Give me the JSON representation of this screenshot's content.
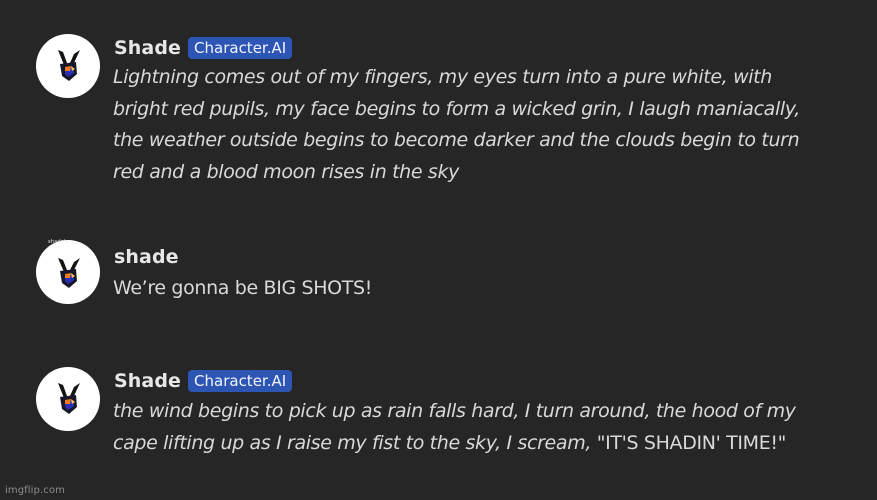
{
  "messages": [
    {
      "author": "Shade",
      "badge": "Character.AI",
      "italic": true,
      "text": "Lightning comes out of my fingers, my eyes turn into a pure white, with\nbright red pupils, my face begins to form a wicked grin, I laugh maniacally,\nthe weather outside begins to become darker and the clouds begin to turn\nred and a blood moon rises in the sky",
      "avatar_icon": "shadow-character-avatar-icon"
    },
    {
      "author": "shade",
      "badge": "",
      "italic": false,
      "avatar_caption": "shade's",
      "text": "We’re gonna be BIG SHOTS!",
      "avatar_icon": "shadow-character-avatar-icon"
    },
    {
      "author": "Shade",
      "badge": "Character.AI",
      "italic": true,
      "text_italic": "the wind begins to pick up as rain falls hard, I turn around, the hood of my\ncape lifting up as I raise my fist to the sky, I scream,  ",
      "text_upright": "\"IT'S SHADIN' TIME!\"",
      "avatar_icon": "shadow-character-avatar-icon"
    }
  ],
  "watermark": "imgflip.com",
  "colors": {
    "background": "#262627",
    "badge": "#2d56b4",
    "text": "#d9d9dc",
    "author": "#e7e7e9"
  }
}
